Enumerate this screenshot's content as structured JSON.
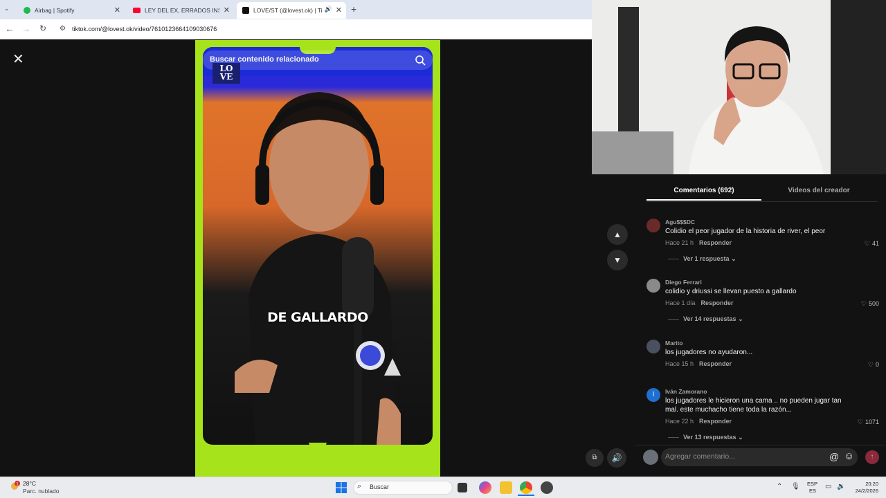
{
  "browser": {
    "tabs": [
      {
        "title": "Airbag | Spotify",
        "favicon": "spotify-icon",
        "color": "#1db954",
        "active": false
      },
      {
        "title": "LEY DEL EX, ERRADOS INSÓLITOS",
        "favicon": "youtube-icon",
        "color": "#ff0033",
        "active": false
      },
      {
        "title": "LOVE/ST (@lovest.ok) | TikTok",
        "favicon": "tiktok-icon",
        "color": "#111111",
        "active": true
      }
    ],
    "new_tab_symbol": "+",
    "url": "tiktok.com/@lovest.ok/video/7610123664109030676"
  },
  "video": {
    "search_placeholder": "Buscar contenido relacionado",
    "logo_line1": "LO",
    "logo_line2": "VE",
    "caption": "DE GALLARDO",
    "accent_color": "#a7e31a"
  },
  "panel": {
    "tab_comments": "Comentarios (692)",
    "tab_videos": "Videos del creador",
    "reply_label": "Responder",
    "comments": [
      {
        "user": "Agu$$$DC",
        "text": "Colidio el peor jugador de la historia de river, el peor",
        "time": "Hace 21 h",
        "likes": "41",
        "replies": "Ver 1 respuesta",
        "avatar_color": "#6b2a2a"
      },
      {
        "user": "Diego Ferrari",
        "text": "colidio y driussi se llevan puesto a gallardo",
        "time": "Hace 1 día",
        "likes": "500",
        "replies": "Ver 14 respuestas",
        "avatar_color": "#8a8a8a"
      },
      {
        "user": "Marito",
        "text": "los jugadores no ayudaron...",
        "time": "Hace 15 h",
        "likes": "0",
        "replies": "",
        "avatar_color": "#4a5060"
      },
      {
        "user": "Iván Zamorano",
        "text": "los jugadores le hicieron una cama .. no pueden jugar tan mal. este muchacho tiene toda la razón...",
        "time": "Hace 22 h",
        "likes": "1071",
        "replies": "Ver 13 respuestas",
        "avatar_letter": "I",
        "avatar_color": "#1f6fd0"
      }
    ],
    "comment_placeholder": "Agregar comentario..."
  },
  "taskbar": {
    "temperature": "28°C",
    "weather": "Parc. nublado",
    "search": "Buscar",
    "lang1": "ESP",
    "lang2": "ES",
    "time": "20:20",
    "date": "24/2/2026",
    "notification_count": "1"
  }
}
